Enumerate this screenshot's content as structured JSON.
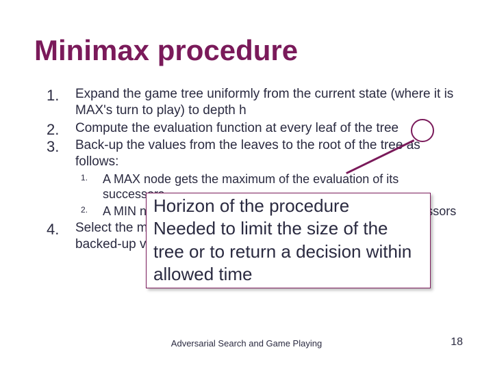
{
  "title": "Minimax procedure",
  "items": [
    "Expand the game tree uniformly from the current state (where it is MAX's turn to play) to depth h",
    "Compute the evaluation function at every leaf of the tree",
    "Back-up the values from the leaves to the root of the tree as follows:",
    "Select the move toward the MIN node that has the maximal backed-up value"
  ],
  "subitems": [
    "A MAX node gets the maximum of the evaluation of its successors",
    "A MIN node gets the minimum of the evaluation of its successors"
  ],
  "callout_lines": [
    "Horizon of the procedure",
    "Needed to limit the size of the tree or to return a decision within allowed time"
  ],
  "footer": "Adversarial Search and Game Playing",
  "page_number": "18"
}
